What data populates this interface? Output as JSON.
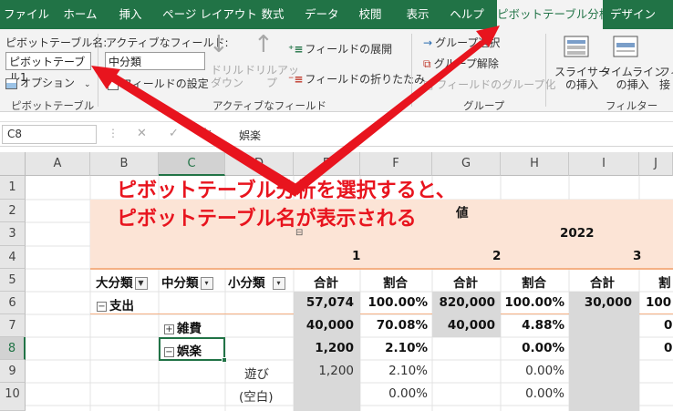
{
  "tabs": [
    "ファイル",
    "ホーム",
    "挿入",
    "ページ レイアウト",
    "数式",
    "データ",
    "校閲",
    "表示",
    "ヘルプ",
    "ピボットテーブル分析",
    "デザイン"
  ],
  "ribbon": {
    "pivot_name_label": "ピボットテーブル名:",
    "pivot_name_value": "ピボットテーブル1",
    "options_label": "オプション",
    "group1_label": "ピボットテーブル",
    "active_field_label": "アクティブなフィールド:",
    "active_field_value": "中分類",
    "field_settings_label": "フィールドの設定",
    "drilldown_label": "ドリル\nダウン",
    "drillup_label": "ドリルアッ\nプ",
    "expand_field_label": "フィールドの展開",
    "collapse_field_label": "フィールドの折りたたみ",
    "group2_label": "アクティブなフィールド",
    "group_selection_label": "グループ選択",
    "ungroup_label": "グループ解除",
    "group_field_label": "フィールドのグループ化",
    "group3_label": "グループ",
    "slicer_label": "スライサー\nの挿入",
    "timeline_label": "タイムライン\nの挿入",
    "filter_conn_label": "フィ\n接",
    "group4_label": "フィルター"
  },
  "formula_bar": {
    "name_box": "C8",
    "cancel": "✕",
    "enter": "✓",
    "fx": "fx",
    "content": "娯楽"
  },
  "columns": [
    "A",
    "B",
    "C",
    "D",
    "E",
    "F",
    "G",
    "H",
    "I",
    "J"
  ],
  "rows": [
    "1",
    "2",
    "3",
    "4",
    "5",
    "6",
    "7",
    "8",
    "9",
    "10"
  ],
  "sheet": {
    "values_label": "値",
    "year": "2022",
    "months": [
      "1",
      "2",
      "3"
    ],
    "header_labels": {
      "major": "大分類",
      "middle": "中分類",
      "minor": "小分類"
    },
    "measure_headers": [
      "合計",
      "割合",
      "合計",
      "割合",
      "合計",
      "割"
    ],
    "rows": [
      {
        "label": "支出",
        "values": [
          "57,074",
          "100.00%",
          "820,000",
          "100.00%",
          "30,000",
          "100"
        ]
      },
      {
        "label": "雑費",
        "values": [
          "40,000",
          "70.08%",
          "40,000",
          "4.88%",
          "",
          "0"
        ]
      },
      {
        "label": "娯楽",
        "values": [
          "1,200",
          "2.10%",
          "",
          "0.00%",
          "",
          "0"
        ]
      },
      {
        "label": "遊び",
        "values": [
          "1,200",
          "2.10%",
          "",
          "0.00%",
          "",
          ""
        ]
      },
      {
        "label": "(空白)",
        "values": [
          "",
          "0.00%",
          "",
          "0.00%",
          "",
          ""
        ]
      }
    ]
  },
  "callout": {
    "line1": "ピボットテーブル分析を選択すると、",
    "line2": "ピボットテーブル名が表示される"
  },
  "colors": {
    "excel_green": "#217346",
    "header_band": "#fce4d6",
    "total_col": "#d9d9d9",
    "arrow": "#e8141e"
  }
}
